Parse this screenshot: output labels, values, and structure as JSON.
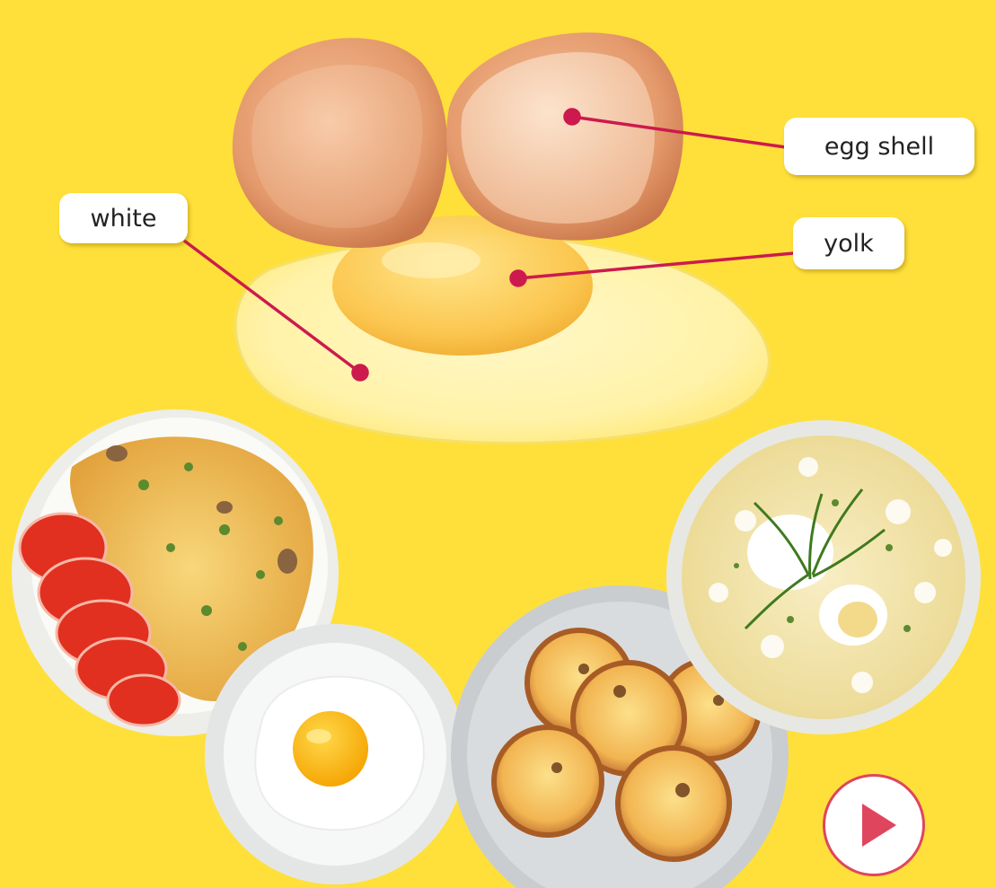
{
  "labels": {
    "white": "white",
    "yolk": "yolk",
    "egg_shell": "egg shell"
  },
  "controls": {
    "play_icon": "play-icon"
  },
  "colors": {
    "background": "#FFE03A",
    "pointer_line": "#CC1A4E",
    "play_accent": "#E0455E"
  }
}
